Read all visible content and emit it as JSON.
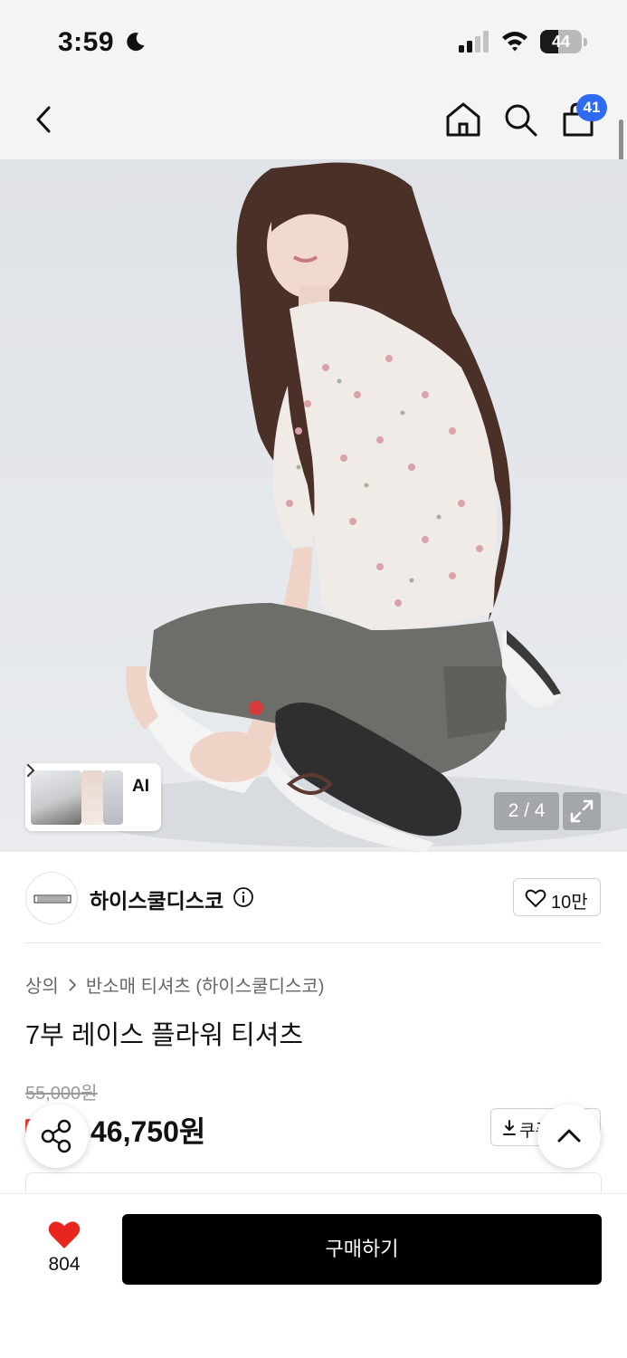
{
  "status_bar": {
    "time": "3:59",
    "battery_level": "44",
    "battery_fraction": 0.44
  },
  "nav": {
    "cart_count": "41"
  },
  "gallery": {
    "ai_label": "AI",
    "counter": "2 / 4"
  },
  "brand": {
    "name": "하이스쿨디스코",
    "logo_text": "HIGHSCHOOLDISCO",
    "likes": "10만"
  },
  "product": {
    "breadcrumb": [
      "상의",
      "반소매 티셔츠 (하이스쿨디스코)"
    ],
    "title": "7부 레이스 플라워 티셔츠",
    "original_price": "55,000원",
    "sale_price": "46,750원",
    "coupon_label": "쿠폰"
  },
  "bottom": {
    "wish_count": "804",
    "buy_label": "구매하기"
  },
  "colors": {
    "accent_blue": "#2f6bf2",
    "heart_red": "#e8261f",
    "discount_red": "#ef3b2f",
    "buy_button": "#000000"
  },
  "icons": [
    "moon-icon",
    "signal-icon",
    "wifi-icon",
    "battery-icon",
    "back-icon",
    "home-icon",
    "search-icon",
    "bag-icon",
    "chevron-right-icon",
    "expand-icon",
    "info-icon",
    "heart-outline-icon",
    "download-icon",
    "share-icon",
    "chevron-up-icon",
    "heart-filled-icon"
  ]
}
